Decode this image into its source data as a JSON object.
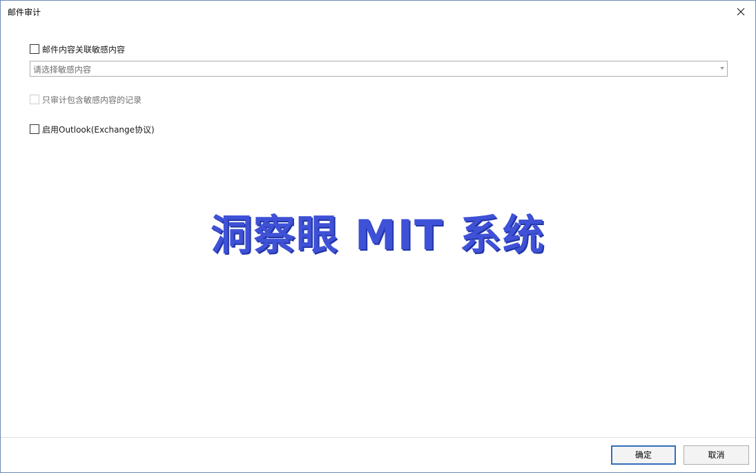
{
  "window": {
    "title": "邮件审计",
    "close_icon": "close-icon"
  },
  "options": {
    "link_sensitive_label": "邮件内容关联敏感内容",
    "link_sensitive_checked": false,
    "sensitive_select_placeholder": "请选择敏感内容",
    "only_sensitive_label": "只审计包含敏感内容的记录",
    "only_sensitive_checked": false,
    "only_sensitive_disabled": true,
    "outlook_label": "启用Outlook(Exchange协议)",
    "outlook_checked": false
  },
  "watermark": {
    "text": "洞察眼 MIT 系统",
    "color": "#3f51d6"
  },
  "footer": {
    "ok_label": "确定",
    "cancel_label": "取消"
  }
}
